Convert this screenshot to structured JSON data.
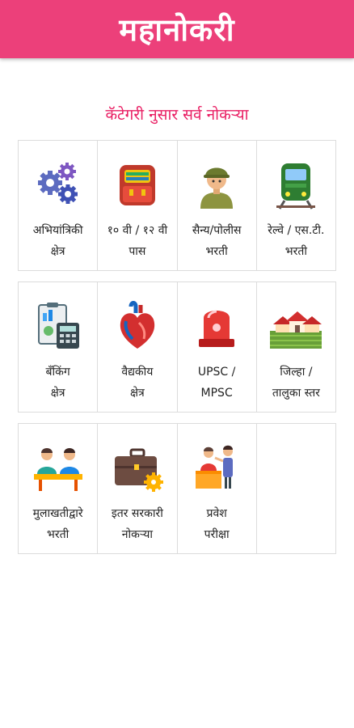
{
  "header": {
    "title": "महानोकरी"
  },
  "subtitle": "कॅटेगरी नुसार सर्व नोकऱ्या",
  "rows": [
    [
      {
        "icon": "gears-icon",
        "label": "अभियांत्रिकी\nक्षेत्र"
      },
      {
        "icon": "backpack-icon",
        "label": "१० वी / १२ वी\nपास"
      },
      {
        "icon": "soldier-icon",
        "label": "सैन्य/पोलीस\nभरती"
      },
      {
        "icon": "train-icon",
        "label": "रेल्वे / एस.टी.\nभरती"
      }
    ],
    [
      {
        "icon": "calculator-icon",
        "label": "बँकिंग\nक्षेत्र"
      },
      {
        "icon": "heart-icon",
        "label": "वैद्यकीय\nक्षेत्र"
      },
      {
        "icon": "siren-icon",
        "label": "UPSC /\nMPSC"
      },
      {
        "icon": "village-icon",
        "label": "जिल्हा /\nतालुका स्तर"
      }
    ],
    [
      {
        "icon": "interview-icon",
        "label": "मुलाखतीद्वारे\nभरती"
      },
      {
        "icon": "briefcase-icon",
        "label": "इतर सरकारी\nनोकऱ्या"
      },
      {
        "icon": "exam-icon",
        "label": "प्रवेश\nपरीक्षा"
      }
    ]
  ]
}
